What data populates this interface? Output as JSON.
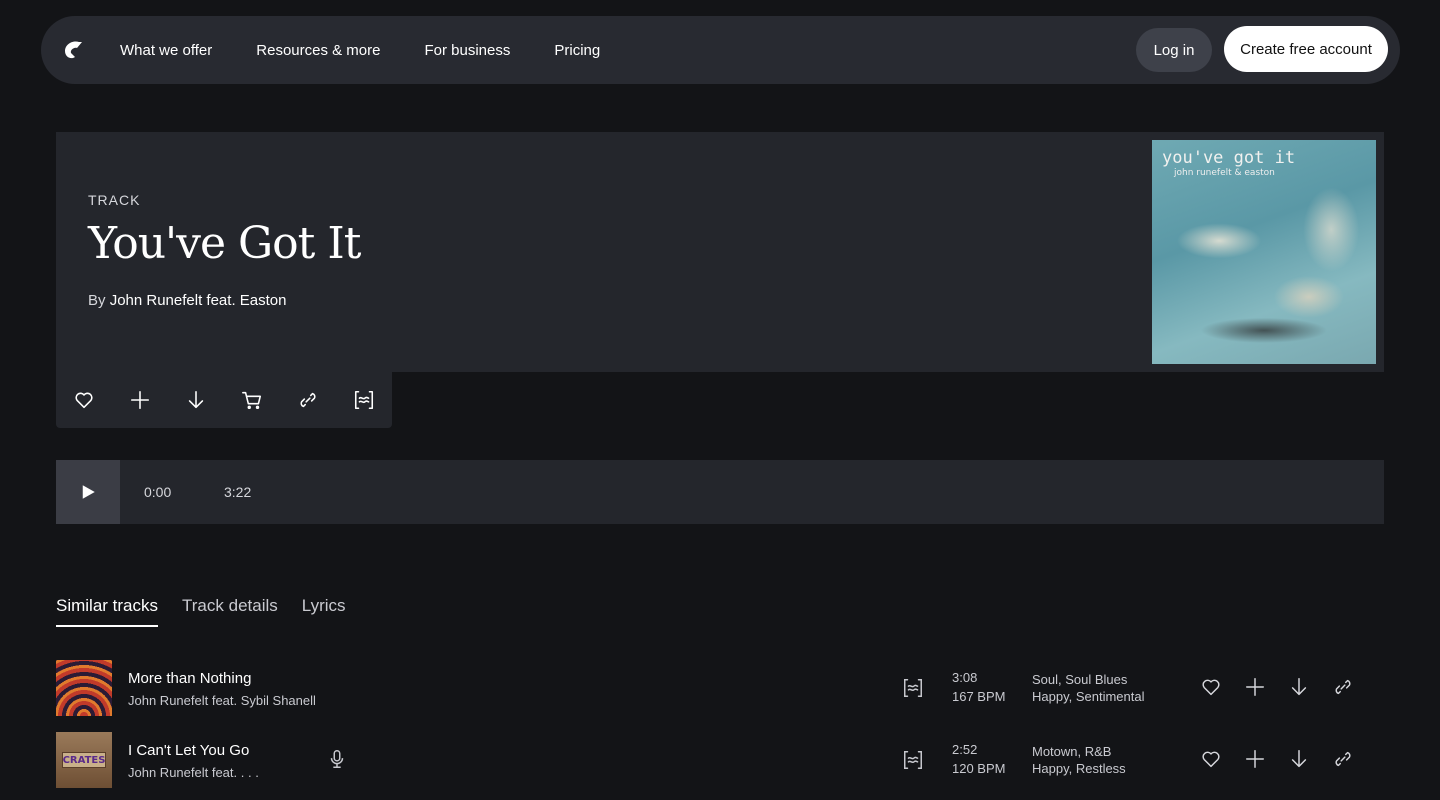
{
  "nav": {
    "links": [
      "What we offer",
      "Resources & more",
      "For business",
      "Pricing"
    ],
    "login": "Log in",
    "create": "Create free account"
  },
  "hero": {
    "label": "TRACK",
    "title": "You've Got It",
    "by_prefix": "By",
    "artist": "John Runefelt feat. Easton",
    "cover_title": "you've got it",
    "cover_sub": "john runefelt & easton"
  },
  "player": {
    "current": "0:00",
    "duration": "3:22"
  },
  "tabs": [
    "Similar tracks",
    "Track details",
    "Lyrics"
  ],
  "tracks": [
    {
      "title": "More than Nothing",
      "artist": "John Runefelt feat. Sybil Shanell",
      "duration": "3:08",
      "bpm": "167 BPM",
      "genres": "Soul, Soul Blues",
      "moods": "Happy, Sentimental"
    },
    {
      "title": "I Can't Let You Go",
      "artist": "John Runefelt feat. . . .",
      "duration": "2:52",
      "bpm": "120 BPM",
      "genres": "Motown, R&B",
      "moods": "Happy, Restless",
      "cover_text": "CRATES"
    }
  ]
}
